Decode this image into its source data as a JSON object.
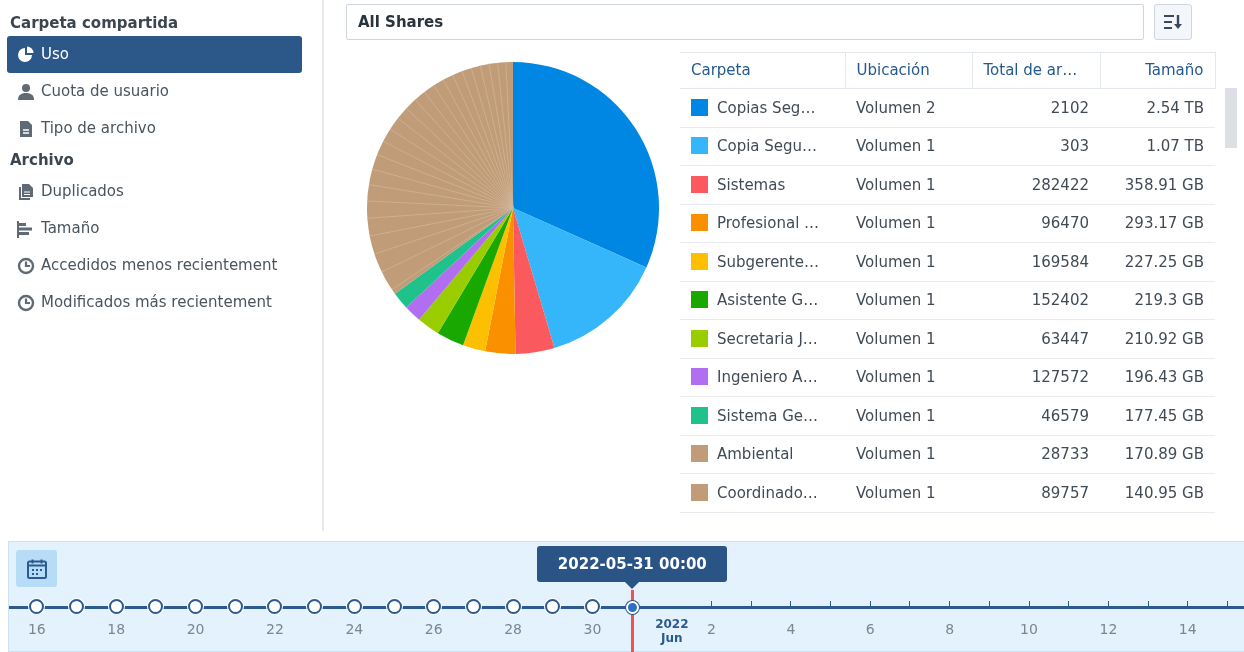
{
  "sidebar": [
    {
      "heading": "Carpeta compartida",
      "items": [
        {
          "label": "Uso",
          "selected": true
        },
        {
          "label": "Cuota de usuario",
          "selected": false
        },
        {
          "label": "Tipo de archivo",
          "selected": false
        }
      ]
    },
    {
      "heading": "Archivo",
      "items": [
        {
          "label": "Duplicados",
          "selected": false
        },
        {
          "label": "Tamaño",
          "selected": false
        },
        {
          "label": "Accedidos menos recientement",
          "selected": false
        },
        {
          "label": "Modificados más recientement",
          "selected": false
        }
      ]
    }
  ],
  "share_select": {
    "value": "All Shares"
  },
  "table": {
    "columns": [
      "Carpeta",
      "Ubicación",
      "Total de ar…",
      "Tamaño"
    ],
    "rows": [
      {
        "color": "#0086e3",
        "name": "Copias Seg…",
        "location": "Volumen 2",
        "count": "2102",
        "size": "2.54 TB"
      },
      {
        "color": "#36b6fa",
        "name": "Copia Segu…",
        "location": "Volumen 1",
        "count": "303",
        "size": "1.07 TB"
      },
      {
        "color": "#fa5a5e",
        "name": "Sistemas",
        "location": "Volumen 1",
        "count": "282422",
        "size": "358.91 GB"
      },
      {
        "color": "#fa9000",
        "name": "Profesional …",
        "location": "Volumen 1",
        "count": "96470",
        "size": "293.17 GB"
      },
      {
        "color": "#fcc000",
        "name": "Subgerente…",
        "location": "Volumen 1",
        "count": "169584",
        "size": "227.25 GB"
      },
      {
        "color": "#18a800",
        "name": "Asistente G…",
        "location": "Volumen 1",
        "count": "152402",
        "size": "219.3 GB"
      },
      {
        "color": "#9acd00",
        "name": "Secretaria J…",
        "location": "Volumen 1",
        "count": "63447",
        "size": "210.92 GB"
      },
      {
        "color": "#b26ef0",
        "name": "Ingeniero A…",
        "location": "Volumen 1",
        "count": "127572",
        "size": "196.43 GB"
      },
      {
        "color": "#1ec28a",
        "name": "Sistema Ge…",
        "location": "Volumen 1",
        "count": "46579",
        "size": "177.45 GB"
      },
      {
        "color": "#c19c78",
        "name": "Ambiental",
        "location": "Volumen 1",
        "count": "28733",
        "size": "170.89 GB"
      },
      {
        "color": "#c19c78",
        "name": "Coordinado…",
        "location": "Volumen 1",
        "count": "89757",
        "size": "140.95 GB"
      }
    ]
  },
  "timeline": {
    "tooltip": "2022-05-31 00:00",
    "month_year": "2022",
    "month": "Jun",
    "days": [
      {
        "kind": "snapshot",
        "label": "16",
        "selected": false
      },
      {
        "kind": "snapshot",
        "selected": false
      },
      {
        "kind": "snapshot",
        "label": "18",
        "selected": false
      },
      {
        "kind": "snapshot",
        "selected": false
      },
      {
        "kind": "snapshot",
        "label": "20",
        "selected": false
      },
      {
        "kind": "snapshot",
        "selected": false
      },
      {
        "kind": "snapshot",
        "label": "22",
        "selected": false
      },
      {
        "kind": "snapshot",
        "selected": false
      },
      {
        "kind": "snapshot",
        "label": "24",
        "selected": false
      },
      {
        "kind": "snapshot",
        "selected": false
      },
      {
        "kind": "snapshot",
        "label": "26",
        "selected": false
      },
      {
        "kind": "snapshot",
        "selected": false
      },
      {
        "kind": "snapshot",
        "label": "28",
        "selected": false
      },
      {
        "kind": "snapshot",
        "selected": false
      },
      {
        "kind": "snapshot",
        "label": "30",
        "selected": false
      },
      {
        "kind": "snapshot",
        "selected": true
      },
      {
        "kind": "month"
      },
      {
        "kind": "tick",
        "label": "2"
      },
      {
        "kind": "tick"
      },
      {
        "kind": "tick",
        "label": "4"
      },
      {
        "kind": "tick"
      },
      {
        "kind": "tick",
        "label": "6"
      },
      {
        "kind": "tick"
      },
      {
        "kind": "tick",
        "label": "8"
      },
      {
        "kind": "tick"
      },
      {
        "kind": "tick",
        "label": "10"
      },
      {
        "kind": "tick"
      },
      {
        "kind": "tick",
        "label": "12"
      },
      {
        "kind": "tick"
      },
      {
        "kind": "tick",
        "label": "14"
      },
      {
        "kind": "tick"
      }
    ]
  }
}
